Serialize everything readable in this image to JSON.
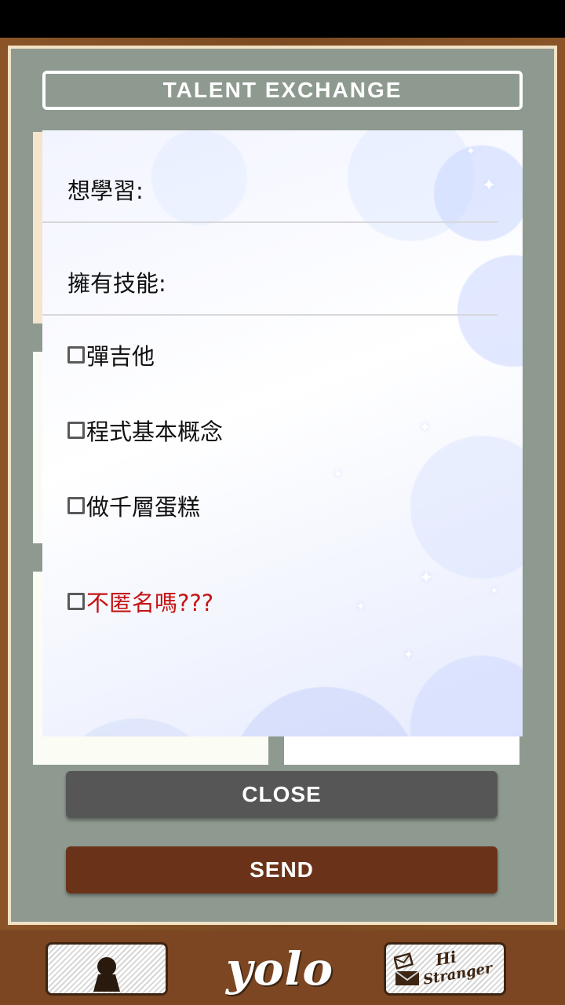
{
  "header": {
    "title": "TALENT EXCHANGE"
  },
  "dialog": {
    "fields": [
      {
        "label": "想學習:"
      },
      {
        "label": "擁有技能:"
      }
    ],
    "skills": [
      {
        "label": "彈吉他",
        "checked": false
      },
      {
        "label": "程式基本概念",
        "checked": false
      },
      {
        "label": "做千層蛋糕",
        "checked": false
      }
    ],
    "anonymous": {
      "label": "不匿名嗎???",
      "checked": false,
      "color": "#c41414"
    }
  },
  "buttons": {
    "close_label": "CLOSE",
    "send_label": "SEND"
  },
  "bottom_nav": {
    "left_icon": "keyhole-icon",
    "logo": "yolo",
    "right_tile": {
      "hi": "Hi",
      "stranger": "Stranger",
      "icon": "envelope-icon"
    }
  },
  "colors": {
    "frame_wood": "#8a5428",
    "panel": "#8e9a90",
    "close_button": "#565656",
    "send_button": "#6a3319",
    "warning_text": "#c41414"
  }
}
